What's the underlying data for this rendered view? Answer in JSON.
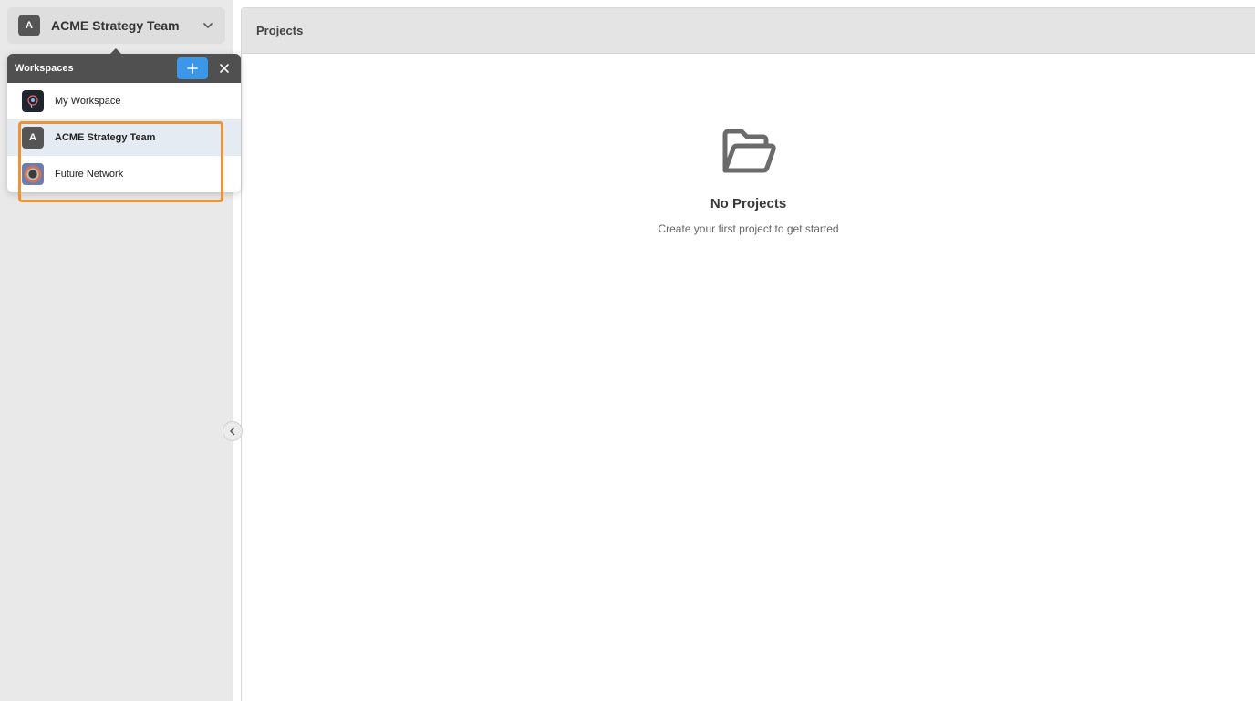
{
  "sidebar": {
    "switcher": {
      "avatar_letter": "A",
      "name": "ACME Strategy Team",
      "icon": "chevron-down-icon"
    },
    "collapse_icon": "chevron-left-icon"
  },
  "popover": {
    "title": "Workspaces",
    "add_icon": "plus-icon",
    "close_icon": "close-icon",
    "items": [
      {
        "label": "My Workspace",
        "icon": "workspace-logo-icon",
        "active": false
      },
      {
        "label": "ACME Strategy Team",
        "icon_letter": "A",
        "active": true
      },
      {
        "label": "Future Network",
        "icon": "network-logo-icon",
        "active": false
      }
    ]
  },
  "main": {
    "header_title": "Projects",
    "empty_state": {
      "icon": "folder-open-icon",
      "heading": "No Projects",
      "subtext": "Create your first project to get started"
    }
  },
  "colors": {
    "accent": "#3d97e8",
    "highlight": "#ef9233",
    "popover_header": "#505050",
    "active_row": "#e4ebf3"
  }
}
